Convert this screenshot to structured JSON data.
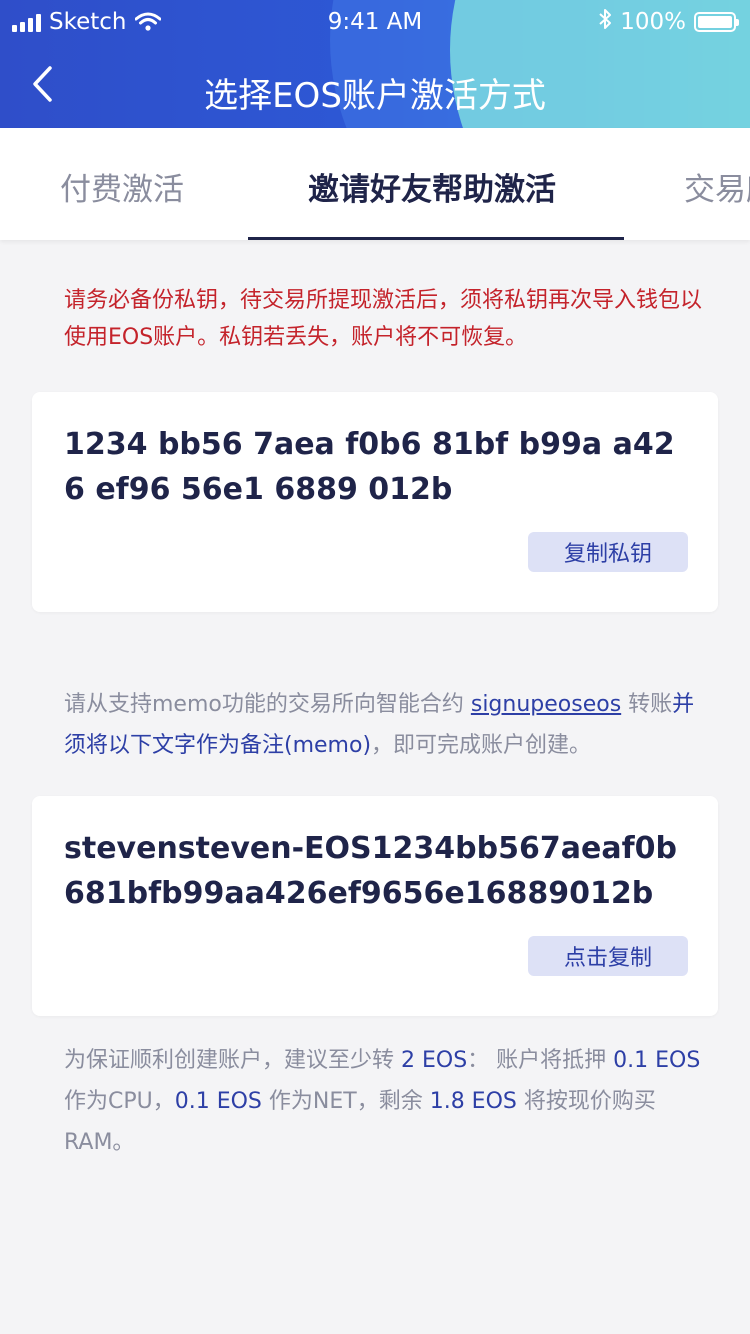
{
  "status_bar": {
    "carrier": "Sketch",
    "time": "9:41 AM",
    "battery": "100%"
  },
  "nav": {
    "title": "选择EOS账户激活方式"
  },
  "tabs": [
    {
      "label": "付费激活"
    },
    {
      "label": "邀请好友帮助激活"
    },
    {
      "label": "交易所"
    }
  ],
  "warning": "请务必备份私钥，待交易所提现激活后，须将私钥再次导入钱包以使用EOS账户。私钥若丢失，账户将不可恢复。",
  "private_key_card": {
    "key": "1234 bb56 7aea f0b6 81bf b99a a426 ef96 56e1 6889 012b",
    "button": "复制私钥"
  },
  "memo_info": {
    "prefix": "请从支持memo功能的交易所向智能合约 ",
    "contract": "signupeoseos",
    "middle": " 转账",
    "highlight": "并须将以下文字作为备注(memo)",
    "suffix": "，即可完成账户创建。"
  },
  "memo_card": {
    "text": "stevensteven-EOS1234bb567aeaf0b681bfb99aa426ef9656e16889012b",
    "button": "点击复制"
  },
  "hint": {
    "p1": "为保证顺利创建账户，建议至少转 ",
    "v1": "2 EOS",
    "p2": "： 账户将抵押 ",
    "v2": "0.1 EOS",
    "p3": " 作为CPU，",
    "v3": "0.1 EOS",
    "p4": " 作为NET，剩余 ",
    "v4": "1.8 EOS",
    "p5": " 将按现价购买RAM。"
  },
  "colors": {
    "accent": "#2d3fa6",
    "warning": "#c4232b",
    "text_dark": "#1f2449",
    "text_muted": "#8a8d9e"
  },
  "icons": {
    "back": "chevron-left-icon",
    "wifi": "wifi-icon",
    "bluetooth": "bluetooth-icon",
    "battery": "battery-icon",
    "signal": "signal-icon"
  }
}
